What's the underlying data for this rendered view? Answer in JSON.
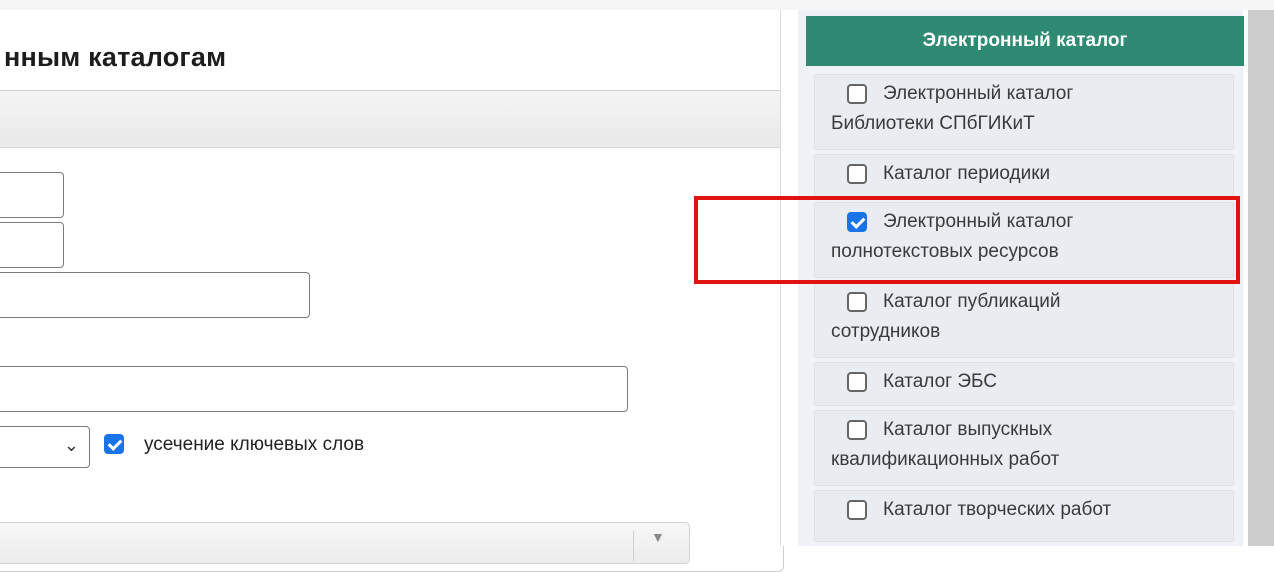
{
  "page": {
    "title": "нным каталогам"
  },
  "search_form": {
    "truncation_label": "усечение ключевых слов",
    "truncation_checked": true
  },
  "sidebar": {
    "header": "Электронный каталог",
    "items": [
      {
        "line1": "Электронный каталог",
        "line2": "Библиотеки СПбГИКиТ",
        "checked": false
      },
      {
        "line1": "Каталог периодики",
        "line2": "",
        "checked": false
      },
      {
        "line1": "Электронный каталог",
        "line2": "полнотекстовых ресурсов",
        "checked": true
      },
      {
        "line1": "Каталог публикаций",
        "line2": "сотрудников",
        "checked": false
      },
      {
        "line1": "Каталог ЭБС",
        "line2": "",
        "checked": false
      },
      {
        "line1": "Каталог выпускных",
        "line2": "квалификационных работ",
        "checked": false
      },
      {
        "line1": "Каталог творческих работ",
        "line2": "",
        "checked": false
      }
    ]
  },
  "colors": {
    "header_green": "#2e8a73",
    "checkbox_blue": "#1a73e8",
    "highlight_red": "#e11212"
  }
}
